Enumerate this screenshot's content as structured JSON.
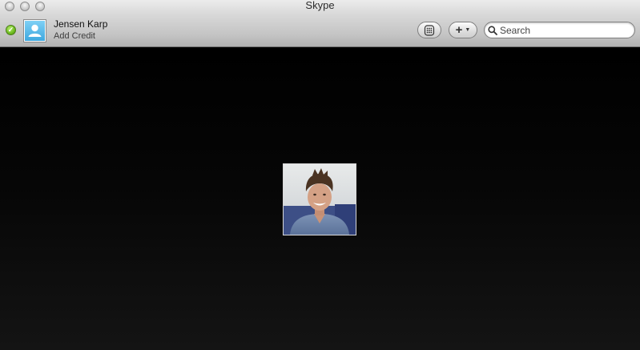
{
  "window": {
    "title": "Skype"
  },
  "account": {
    "name": "Jensen Karp",
    "credit_link": "Add Credit",
    "status": "online",
    "status_color": "#6dbb1f"
  },
  "toolbar": {
    "dial_icon": "dialpad-icon",
    "add_icon": "plus-icon",
    "add_menu_icon": "chevron-down-icon"
  },
  "search": {
    "placeholder": "Search",
    "value": ""
  },
  "call": {
    "contact_photo": "contact-photo",
    "background_color": "#000000"
  }
}
